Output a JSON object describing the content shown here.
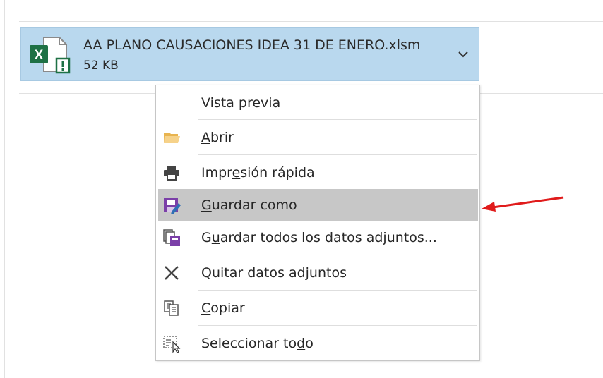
{
  "attachment": {
    "filename": "AA PLANO CAUSACIONES IDEA 31 DE ENERO.xlsm",
    "size": "52 KB",
    "file_icon": "excel-macro-file-icon",
    "dropdown_icon": "chevron-down-icon"
  },
  "context_menu": {
    "items": [
      {
        "label": "Vista previa",
        "mnemonic": "V",
        "icon": "none"
      },
      {
        "label": "Abrir",
        "mnemonic": "A",
        "icon": "folder-icon"
      },
      {
        "label": "Impresión rápida",
        "mnemonic": "e",
        "icon": "printer-icon"
      },
      {
        "label": "Guardar como",
        "mnemonic": "G",
        "icon": "save-as-icon",
        "highlighted": true
      },
      {
        "label": "Guardar todos los datos adjuntos...",
        "mnemonic": "u",
        "icon": "save-all-attachments-icon"
      },
      {
        "label": "Quitar datos adjuntos",
        "mnemonic": "Q",
        "icon": "remove-x-icon"
      },
      {
        "label": "Copiar",
        "mnemonic": "C",
        "icon": "copy-icon"
      },
      {
        "label": "Seleccionar todo",
        "mnemonic": "d",
        "icon": "select-all-icon"
      }
    ]
  },
  "colors": {
    "attachment_bg": "#b9d8ee",
    "highlight_bg": "#c7c7c7",
    "excel_green": "#1e7145",
    "arrow_red": "#e01b1b"
  }
}
